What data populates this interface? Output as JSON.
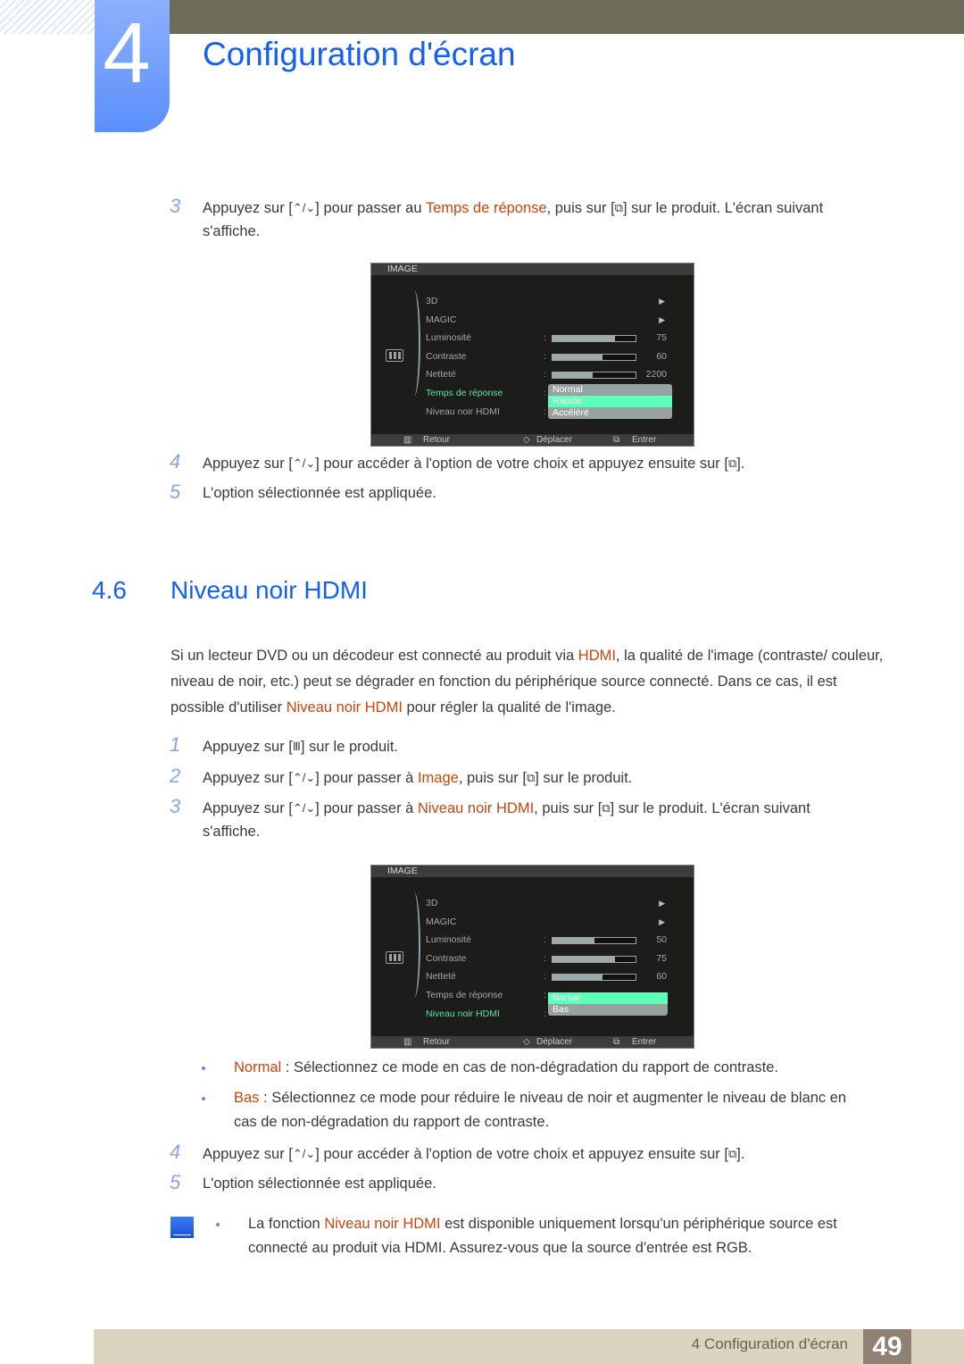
{
  "header": {
    "chapter_number": "4",
    "chapter_title": "Configuration d'écran"
  },
  "colors": {
    "accent_blue": "#1460f5",
    "highlight_orange": "#c8450c",
    "osd_active_green": "#5fe3a4",
    "osd_selected_bg": "#5effb9",
    "header_bar": "#6d6b59",
    "footer_band": "#dbd4c0"
  },
  "sec45": {
    "step3": {
      "num": "3",
      "pre": "Appuyez sur [",
      "key1": "⌃/⌄",
      "mid": "] pour passer au ",
      "hl": "Temps de réponse",
      "mid2": ", puis sur [",
      "key2": "⧉",
      "post": "] sur le produit. L'écran suivant",
      "line2": "s'affiche."
    },
    "osd": {
      "title": "IMAGE",
      "items": [
        {
          "label": "3D",
          "type": "arrow"
        },
        {
          "label": "MAGIC",
          "type": "arrow"
        },
        {
          "label": "Luminosité",
          "type": "bar",
          "value": "75",
          "fill": 0.75
        },
        {
          "label": "Contraste",
          "type": "bar",
          "value": "60",
          "fill": 0.6
        },
        {
          "label": "Netteté",
          "type": "bar",
          "value": "2200",
          "fill": 0.48
        },
        {
          "label": "Temps de réponse",
          "type": "dropdown",
          "active": true
        },
        {
          "label": "Niveau noir HDMI",
          "type": "none"
        }
      ],
      "dropdown": [
        "Normal",
        "Rapide",
        "Accéléré"
      ],
      "dropdown_selected": "Rapide",
      "footer": {
        "back": "Retour",
        "move": "Déplacer",
        "enter": "Entrer"
      }
    },
    "step4": {
      "num": "4",
      "pre": "Appuyez sur [",
      "key1": "⌃/⌄",
      "post": "] pour accéder à l'option de votre choix et appuyez ensuite sur [",
      "key2": "⧉",
      "end": "]."
    },
    "step5": {
      "num": "5",
      "text": "L'option sélectionnée est appliquée."
    }
  },
  "sec46": {
    "number": "4.6",
    "title": "Niveau noir HDMI",
    "intro": {
      "p1": "Si un lecteur DVD ou un décodeur est connecté au produit via ",
      "hl1": "HDMI",
      "p2": ", la qualité de l'image (contraste/ couleur, niveau de noir, etc.) peut se dégrader en fonction du périphérique source connecté. Dans ce cas, il est possible d'utiliser ",
      "hl2": "Niveau noir HDMI",
      "p3": " pour régler la qualité de l'image."
    },
    "step1": {
      "num": "1",
      "pre": "Appuyez sur [",
      "key": "Ⅲ",
      "post": "] sur le produit."
    },
    "step2": {
      "num": "2",
      "pre": "Appuyez sur [",
      "key1": "⌃/⌄",
      "mid": "] pour passer à ",
      "hl": "Image",
      "mid2": ", puis sur [",
      "key2": "⧉",
      "post": "] sur le produit."
    },
    "step3": {
      "num": "3",
      "pre": "Appuyez sur [",
      "key1": "⌃/⌄",
      "mid": "] pour passer à ",
      "hl": "Niveau noir HDMI",
      "mid2": ", puis sur [",
      "key2": "⧉",
      "post": "] sur le produit. L'écran suivant",
      "line2": "s'affiche."
    },
    "osd": {
      "title": "IMAGE",
      "items": [
        {
          "label": "3D",
          "type": "arrow"
        },
        {
          "label": "MAGIC",
          "type": "arrow"
        },
        {
          "label": "Luminosité",
          "type": "bar",
          "value": "50",
          "fill": 0.5
        },
        {
          "label": "Contraste",
          "type": "bar",
          "value": "75",
          "fill": 0.75
        },
        {
          "label": "Netteté",
          "type": "bar",
          "value": "60",
          "fill": 0.6
        },
        {
          "label": "Temps de réponse",
          "type": "none"
        },
        {
          "label": "Niveau noir HDMI",
          "type": "dropdown",
          "active": true
        }
      ],
      "dropdown": [
        "Nomal",
        "Bas"
      ],
      "dropdown_selected": "Nomal",
      "footer": {
        "back": "Retour",
        "move": "Déplacer",
        "enter": "Entrer"
      }
    },
    "bullets": [
      {
        "hl": "Normal",
        "text": " : Sélectionnez ce mode en cas de non-dégradation du rapport de contraste.",
        "line2": ""
      },
      {
        "hl": "Bas",
        "text": " : Sélectionnez ce mode pour réduire le niveau de noir et augmenter le niveau de blanc en",
        "line2": "cas de non-dégradation du rapport de contraste."
      }
    ],
    "step4": {
      "num": "4",
      "pre": "Appuyez sur [",
      "key1": "⌃/⌄",
      "post": "] pour accéder à l'option de votre choix et appuyez ensuite sur [",
      "key2": "⧉",
      "end": "]."
    },
    "step5": {
      "num": "5",
      "text": "L'option sélectionnée est appliquée."
    },
    "note": {
      "pre": "La fonction ",
      "hl": "Niveau noir HDMI",
      "post": " est disponible uniquement lorsqu'un périphérique source est",
      "line2": "connecté au produit via HDMI. Assurez-vous que la source d'entrée est RGB."
    }
  },
  "footer": {
    "chapter_label": "4 Configuration d'écran",
    "page_number": "49"
  }
}
